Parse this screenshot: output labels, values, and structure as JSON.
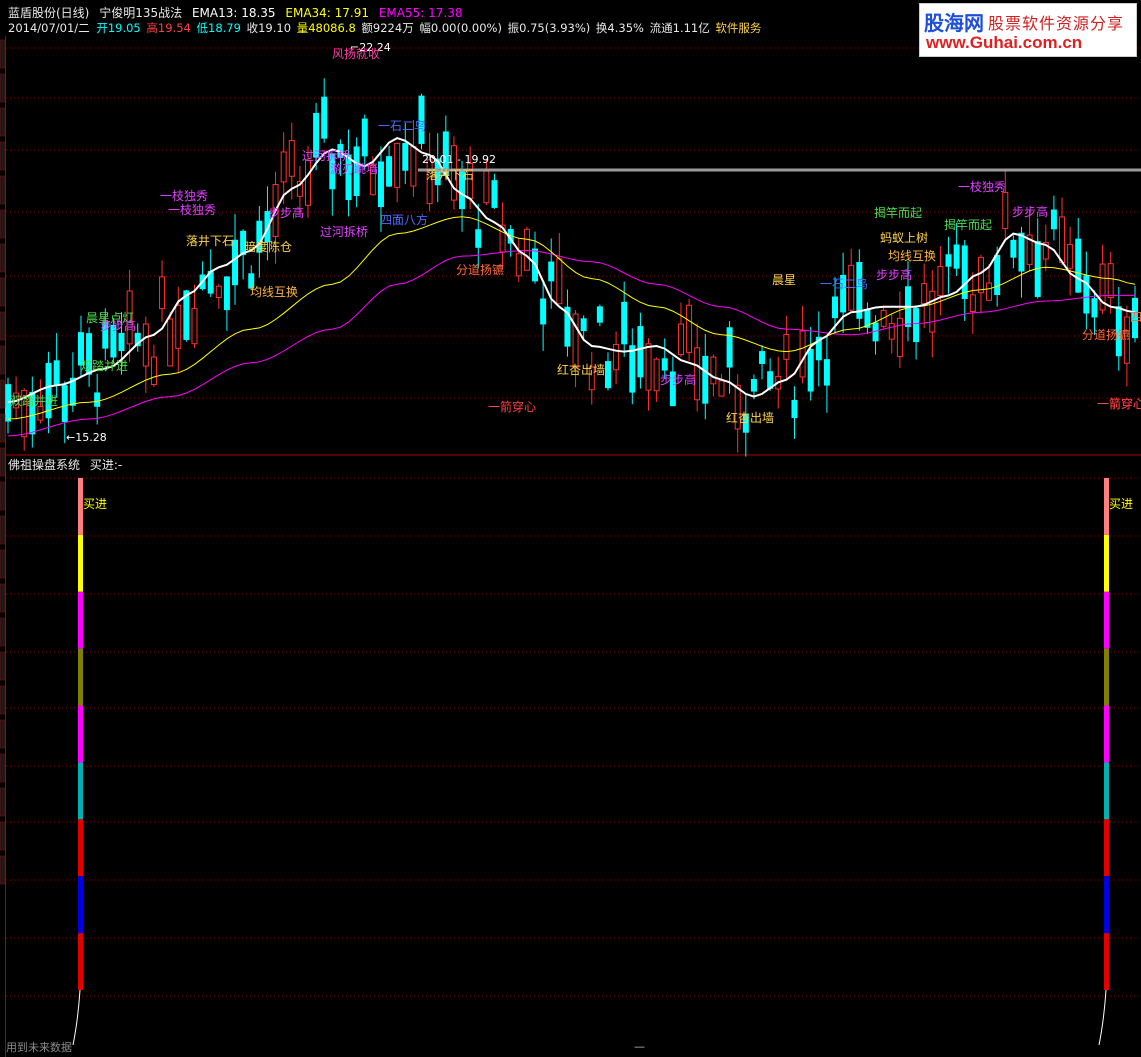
{
  "header": {
    "title": "蓝盾股份(日线)",
    "strategy": "宁俊明135战法",
    "ema13": "EMA13: 18.35",
    "ema34": "EMA34: 17.91",
    "ema55": "EMA55: 17.38",
    "date": "2014/07/01/二",
    "open": "开19.05",
    "high": "高19.54",
    "low": "低18.79",
    "close": "收19.10",
    "volume": "量48086.8",
    "amount": "额9224万",
    "change": "幅0.00(0.00%)",
    "amplitude": "振0.75(3.93%)",
    "turnover": "换4.35%",
    "float": "流通1.11亿",
    "service": "软件服务"
  },
  "watermark": {
    "brand": "股海网",
    "slogan": "股票软件资源分享",
    "url": "www.Guhai.com.cn"
  },
  "price_panel": {
    "high_mark": "22.24",
    "low_mark": "15.28",
    "crosshair_label": "20.01 - 19.92",
    "annotations": [
      {
        "text": "风扬就收",
        "color": "#ff3aa8"
      },
      {
        "text": "一枝独秀",
        "color": "#e040ff"
      },
      {
        "text": "一枝独秀",
        "color": "#e040ff"
      },
      {
        "text": "一石二鸟",
        "color": "#4a6cff"
      },
      {
        "text": "过河拆桥",
        "color": "#e040ff"
      },
      {
        "text": "过河拆桥",
        "color": "#e040ff"
      },
      {
        "text": "游刃跳墙",
        "color": "#e040ff"
      },
      {
        "text": "落井下石",
        "color": "#ffd24a"
      },
      {
        "text": "落井下石",
        "color": "#ffd24a"
      },
      {
        "text": "四面八方",
        "color": "#4a6cff"
      },
      {
        "text": "步步高",
        "color": "#e040ff"
      },
      {
        "text": "暗度陈仓",
        "color": "#ffd24a"
      },
      {
        "text": "均线互换",
        "color": "#ffb43a"
      },
      {
        "text": "晨星点灯",
        "color": "#4ddb4d"
      },
      {
        "text": "双踏并进",
        "color": "#4ddb4d"
      },
      {
        "text": "双踏并进",
        "color": "#4ddb4d"
      },
      {
        "text": "分道扬镳",
        "color": "#ff6a3a"
      },
      {
        "text": "红杏出墙",
        "color": "#ffd24a"
      },
      {
        "text": "红杏出墙",
        "color": "#ffd24a"
      },
      {
        "text": "一箭穿心",
        "color": "#ff4040"
      },
      {
        "text": "一箭穿心",
        "color": "#ff4040"
      },
      {
        "text": "步步高",
        "color": "#e040ff"
      },
      {
        "text": "揭竿而起",
        "color": "#4ddb4d"
      },
      {
        "text": "揭竿而起",
        "color": "#4ddb4d"
      },
      {
        "text": "蚂蚁上树",
        "color": "#ffd24a"
      },
      {
        "text": "均线互换",
        "color": "#ffb43a"
      },
      {
        "text": "一石二鸟",
        "color": "#4a6cff"
      },
      {
        "text": "步步高",
        "color": "#e040ff"
      },
      {
        "text": "一枝独秀",
        "color": "#e040ff"
      },
      {
        "text": "步步高",
        "color": "#e040ff"
      },
      {
        "text": "分道扬镳",
        "color": "#ff6a3a"
      },
      {
        "text": "四",
        "color": "#ff6a3a"
      },
      {
        "text": "一箭穿心",
        "color": "#ff4040"
      },
      {
        "text": "晨星",
        "color": "#ffd24a"
      },
      {
        "text": "步步高",
        "color": "#e040ff"
      }
    ]
  },
  "indicator_panel": {
    "name": "佛祖操盘系统",
    "signal_label": "买进:-",
    "buy_left": "买进",
    "buy_right": "买进",
    "bar_colors": [
      "#ff7f7f",
      "#ffff00",
      "#ff00ff",
      "#808000",
      "#ff00ff",
      "#00b0b0",
      "#e00000",
      "#0000e0",
      "#e00000"
    ]
  },
  "footer": {
    "note": "用到未来数据",
    "dash": "—"
  },
  "colors": {
    "up": "#ff3030",
    "down": "#00ffff",
    "ema13": "#ffffff",
    "ema34": "#ffff00",
    "ema55": "#ff00ff",
    "grid": "#8b0000"
  }
}
